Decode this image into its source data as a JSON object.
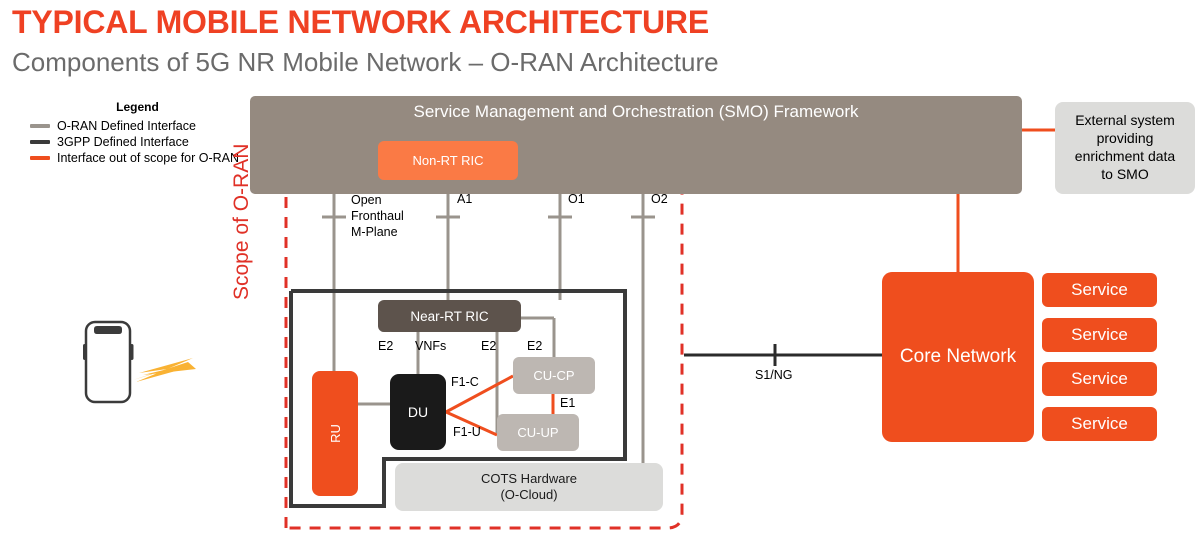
{
  "header": {
    "title": "TYPICAL MOBILE NETWORK ARCHITECTURE",
    "subtitle": "Components of 5G NR Mobile Network – O-RAN Architecture"
  },
  "legend": {
    "title": "Legend",
    "items": [
      {
        "label": "O-RAN Defined Interface",
        "color": "#9a948d"
      },
      {
        "label": "3GPP Defined Interface",
        "color": "#3a3a3a"
      },
      {
        "label": "Interface out of scope for O-RAN",
        "color": "#ef4e1e"
      }
    ]
  },
  "diagram": {
    "scope_label": "Scope of O-RAN",
    "smo": "Service Management and Orchestration (SMO) Framework",
    "non_rt_ric": "Non-RT RIC",
    "near_rt_ric": "Near-RT RIC",
    "ru": "RU",
    "du": "DU",
    "cu_cp": "CU-CP",
    "cu_up": "CU-UP",
    "cots_line1": "COTS Hardware",
    "cots_line2": "(O-Cloud)",
    "core_network": "Core Network",
    "external_line1": "External system",
    "external_line2": "providing",
    "external_line3": "enrichment data",
    "external_line4": "to SMO",
    "services": [
      "Service",
      "Service",
      "Service",
      "Service"
    ],
    "interfaces": {
      "open_fronthaul_1": "Open",
      "open_fronthaul_2": "Fronthaul",
      "open_fronthaul_3": "M-Plane",
      "a1": "A1",
      "o1": "O1",
      "o2": "O2",
      "e2_du": "E2",
      "vnfs": "VNFs",
      "e2_mid": "E2",
      "e2_cucp": "E2",
      "f1c": "F1-C",
      "f1u": "F1-U",
      "e1": "E1",
      "s1ng": "S1/NG"
    }
  },
  "colors": {
    "title_orange": "#ef4123",
    "subtitle_gray": "#6b6b6b",
    "smo_brown": "#958a80",
    "orange": "#ef4e1e",
    "light_orange": "#fa7a45",
    "dark_gray": "#5d534c",
    "mid_gray": "#bdb7b2",
    "pale_gray": "#dcdcda",
    "scope_red": "#e03127",
    "bolt_yellow": "#f9b233"
  }
}
